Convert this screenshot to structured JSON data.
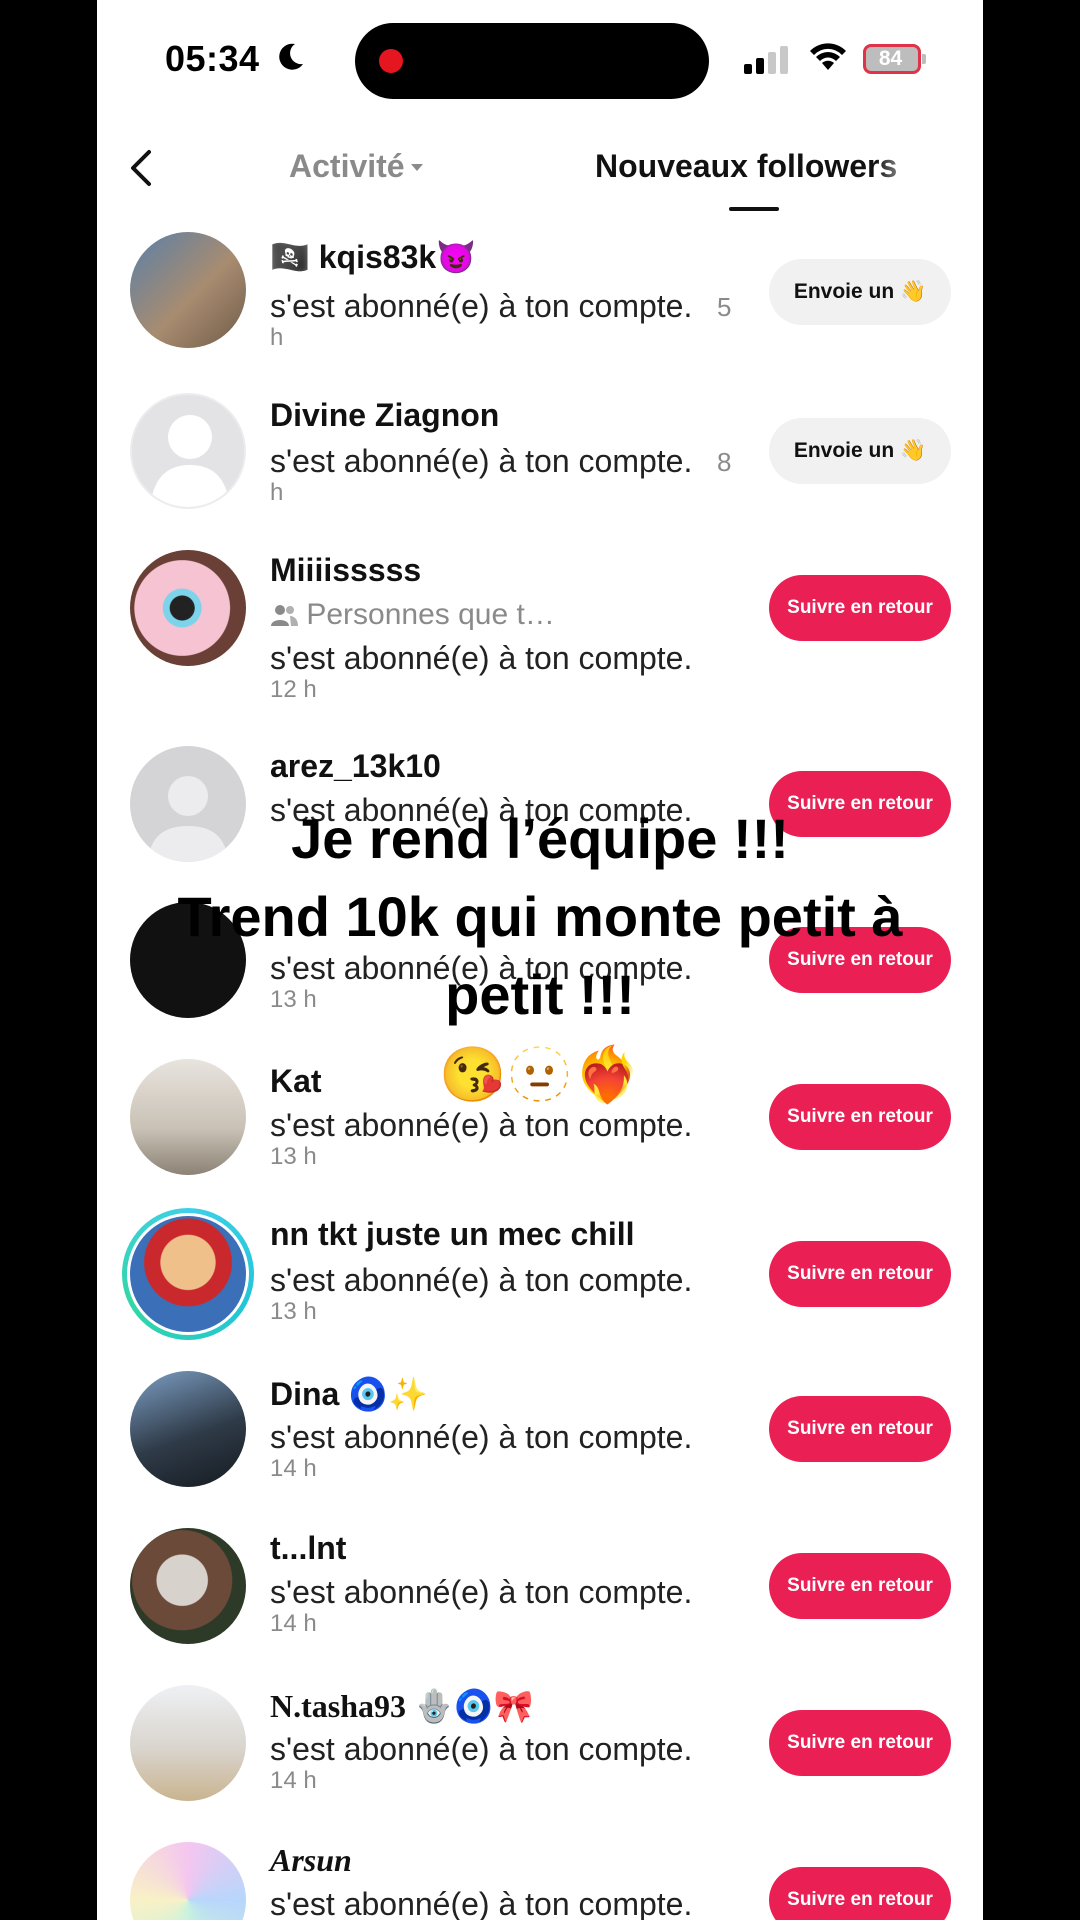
{
  "status_bar": {
    "time": "05:34",
    "battery": "84"
  },
  "header": {
    "tab_activity": "Activité",
    "tab_new_followers": "Nouveaux followers"
  },
  "rows": [
    {
      "name": "🏴‍☠️ kqis83k😈",
      "message": "s'est abonné(e) à ton compte.",
      "time": "5 h",
      "button": "Envoie un 👋"
    },
    {
      "name": "Divine Ziagnon",
      "message": "s'est abonné(e) à ton compte.",
      "time": "8 h",
      "button": "Envoie un 👋"
    },
    {
      "name": "Miiiisssss",
      "sub": "Personnes que t…",
      "message": "s'est abonné(e) à ton compte.",
      "time": "12 h",
      "button": "Suivre en retour"
    },
    {
      "name": "arez_13k10",
      "message": "s'est abonné(e) à ton compte.",
      "button": "Suivre en retour"
    },
    {
      "message": "s'est abonné(e) à ton compte.",
      "time": "13 h",
      "button": "Suivre en retour"
    },
    {
      "name": "Kat",
      "message": "s'est abonné(e) à ton compte.",
      "time": "13 h",
      "button": "Suivre en retour"
    },
    {
      "name": "nn tkt juste un mec chill",
      "message": "s'est abonné(e) à ton compte.",
      "time": "13 h",
      "button": "Suivre en retour"
    },
    {
      "name": "Dina 🧿✨",
      "message": "s'est abonné(e) à ton compte.",
      "time": "14 h",
      "button": "Suivre en retour"
    },
    {
      "name": "t...lnt",
      "message": "s'est abonné(e) à ton compte.",
      "time": "14 h",
      "button": "Suivre en retour"
    },
    {
      "name": "N.tasha93 🪬🧿🎀",
      "message": "s'est abonné(e) à ton compte.",
      "time": "14 h",
      "button": "Suivre en retour"
    },
    {
      "name": "Arsun",
      "message": "s'est abonné(e) à ton compte.",
      "button": "Suivre en retour"
    }
  ],
  "overlay": {
    "line1": "Je rend l’équipe !!!",
    "line2": "Trend 10k qui monte petit à",
    "line3": "petit !!!",
    "emojis": "😘🫥❤️‍🔥"
  }
}
